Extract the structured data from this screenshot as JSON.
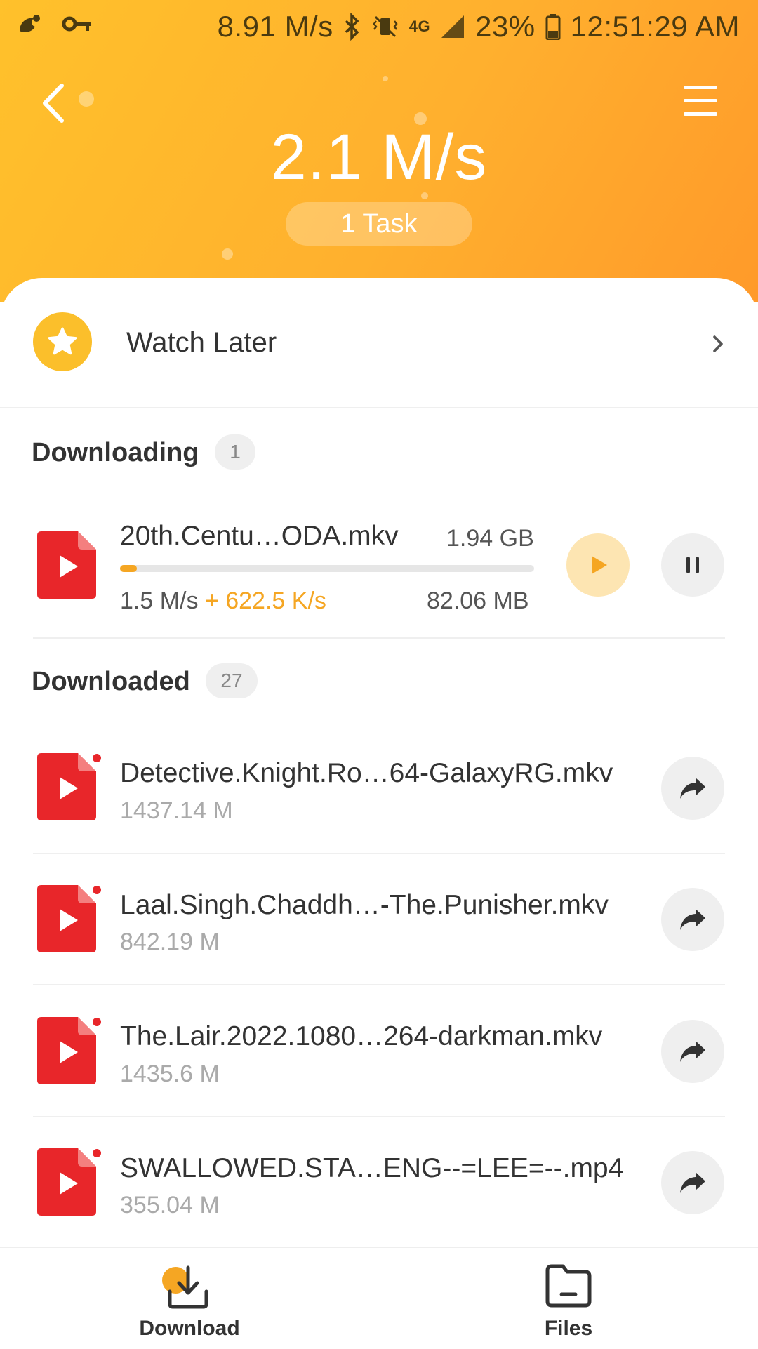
{
  "status_bar": {
    "net_speed": "8.91 M/s",
    "network": "4G",
    "battery": "23%",
    "time": "12:51:29 AM"
  },
  "header": {
    "speed": "2.1 M/s",
    "task_pill": "1 Task"
  },
  "watch_later": {
    "label": "Watch Later"
  },
  "downloading": {
    "title": "Downloading",
    "count": "1",
    "item": {
      "name": "20th.Centu…ODA.mkv",
      "total_size": "1.94 GB",
      "progress": 0.041,
      "speed": "1.5 M/s",
      "boost": "+ 622.5 K/s",
      "downloaded": "82.06 MB"
    }
  },
  "downloaded": {
    "title": "Downloaded",
    "count": "27",
    "items": [
      {
        "name": "Detective.Knight.Ro…64-GalaxyRG.mkv",
        "size": "1437.14 M"
      },
      {
        "name": "Laal.Singh.Chaddh…-The.Punisher.mkv",
        "size": "842.19 M"
      },
      {
        "name": "The.Lair.2022.1080…264-darkman.mkv",
        "size": "1435.6 M"
      },
      {
        "name": "SWALLOWED.STA…ENG--=LEE=--.mp4",
        "size": "355.04 M"
      }
    ]
  },
  "bottom_nav": {
    "download_label": "Download",
    "files_label": "Files"
  },
  "colors": {
    "accent": "#f5a623",
    "header_start": "#ffc12b",
    "header_end": "#ff9a2a",
    "file_red": "#e8262a"
  }
}
